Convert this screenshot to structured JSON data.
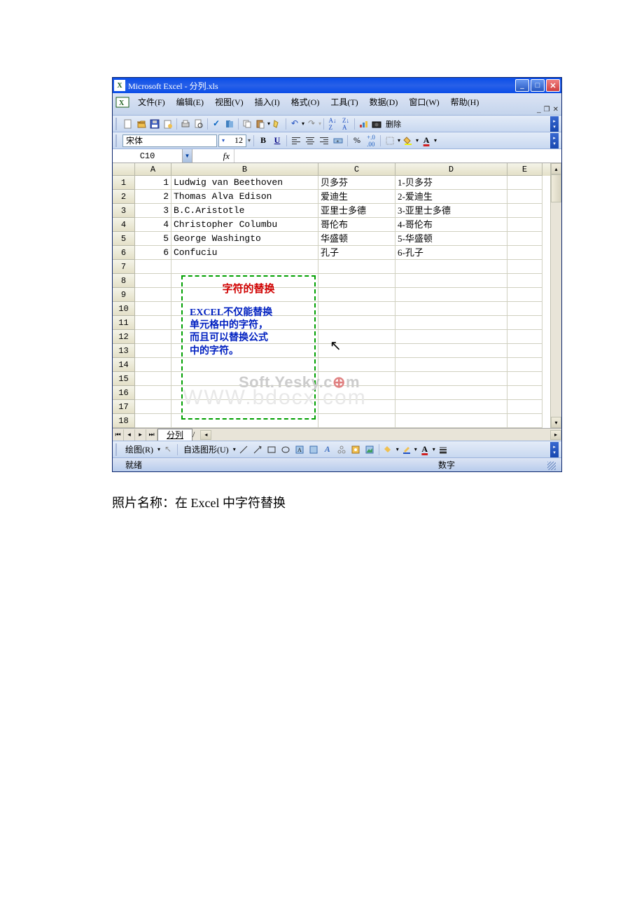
{
  "window": {
    "title": "Microsoft Excel - 分列.xls",
    "controls": {
      "min": "_",
      "max": "□",
      "close": "✕"
    }
  },
  "menu": {
    "items": [
      "文件(F)",
      "编辑(E)",
      "视图(V)",
      "插入(I)",
      "格式(O)",
      "工具(T)",
      "数据(D)",
      "窗口(W)",
      "帮助(H)"
    ],
    "sub": {
      "min": "_",
      "restore": "❐",
      "close": "✕"
    }
  },
  "toolbar": {
    "delete": "删除"
  },
  "format": {
    "font_name": "宋体",
    "font_size": "12"
  },
  "namebox": {
    "cell_ref": "C10",
    "fx": "fx"
  },
  "columns": [
    "A",
    "B",
    "C",
    "D",
    "E"
  ],
  "rows": [
    {
      "n": "1",
      "a": "1",
      "b": "Ludwig van Beethoven",
      "c": "贝多芬",
      "d": "1-贝多芬"
    },
    {
      "n": "2",
      "a": "2",
      "b": "Thomas Alva Edison",
      "c": "爱迪生",
      "d": "2-爱迪生"
    },
    {
      "n": "3",
      "a": "3",
      "b": "B.C.Aristotle",
      "c": "亚里士多德",
      "d": "3-亚里士多德"
    },
    {
      "n": "4",
      "a": "4",
      "b": "Christopher Columbu",
      "c": "哥伦布",
      "d": "4-哥伦布"
    },
    {
      "n": "5",
      "a": "5",
      "b": "George Washingto",
      "c": "华盛顿",
      "d": "5-华盛顿"
    },
    {
      "n": "6",
      "a": "6",
      "b": "Confuciu",
      "c": "孔子",
      "d": "6-孔子"
    },
    {
      "n": "7",
      "a": "",
      "b": "",
      "c": "",
      "d": ""
    },
    {
      "n": "8",
      "a": "",
      "b": "",
      "c": "",
      "d": ""
    },
    {
      "n": "9",
      "a": "",
      "b": "",
      "c": "",
      "d": ""
    },
    {
      "n": "10",
      "a": "",
      "b": "",
      "c": "",
      "d": ""
    },
    {
      "n": "11",
      "a": "",
      "b": "",
      "c": "",
      "d": ""
    },
    {
      "n": "12",
      "a": "",
      "b": "",
      "c": "",
      "d": ""
    },
    {
      "n": "13",
      "a": "",
      "b": "",
      "c": "",
      "d": ""
    },
    {
      "n": "14",
      "a": "",
      "b": "",
      "c": "",
      "d": ""
    },
    {
      "n": "15",
      "a": "",
      "b": "",
      "c": "",
      "d": ""
    },
    {
      "n": "16",
      "a": "",
      "b": "",
      "c": "",
      "d": ""
    },
    {
      "n": "17",
      "a": "",
      "b": "",
      "c": "",
      "d": ""
    },
    {
      "n": "18",
      "a": "",
      "b": "",
      "c": "",
      "d": ""
    }
  ],
  "textbox": {
    "title": "字符的替换",
    "line1": "EXCEL不仅能替换",
    "line2": "单元格中的字符，",
    "line3": "而且可以替换公式",
    "line4": "中的字符。"
  },
  "sheet_tabs": {
    "active": "分列"
  },
  "drawing": {
    "draw": "绘图(R)",
    "autoshape": "自选图形(U)"
  },
  "status": {
    "ready": "就绪",
    "num": "数字"
  },
  "watermarks": {
    "w1a": "Soft.Yesky.c",
    "w1b": "m",
    "w2": "WWW.bdocx.com"
  },
  "caption": "照片名称：在 Excel 中字符替换"
}
